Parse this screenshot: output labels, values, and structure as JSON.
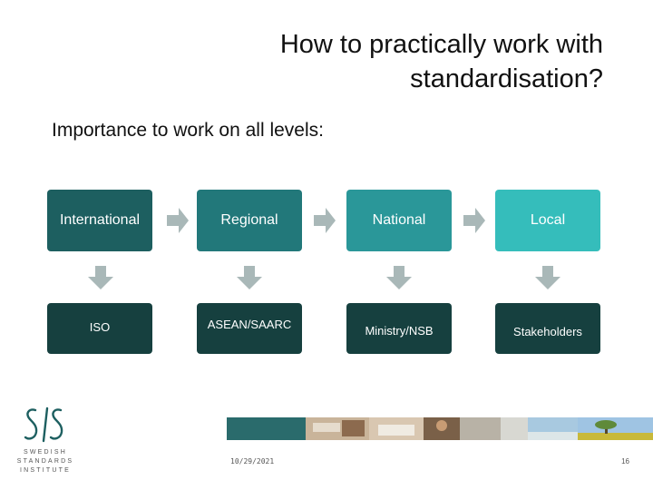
{
  "slide": {
    "title": "How to practically work with standardisation?",
    "subtitle": "Importance to work on all levels:"
  },
  "levels": [
    {
      "label": "International",
      "color": "#1d5f60"
    },
    {
      "label": "Regional",
      "color": "#22787a"
    },
    {
      "label": "National",
      "color": "#2a9799"
    },
    {
      "label": "Local",
      "color": "#35bdbb"
    }
  ],
  "organizations": [
    {
      "label": "ISO"
    },
    {
      "label": "ASEAN/SAARC"
    },
    {
      "label": "Ministry/NSB"
    },
    {
      "label": "Stakeholders"
    }
  ],
  "logo": {
    "mark": "SIS",
    "text": "SWEDISH STANDARDS INSTITUTE",
    "lines": [
      "SWEDISH",
      "STANDARDS",
      "INSTITUTE"
    ]
  },
  "footer": {
    "date": "10/29/2021",
    "page": "16"
  },
  "colors": {
    "arrow": "#a9b8b8",
    "org_box": "#16403f",
    "strip_teal": "#2a6b6c"
  }
}
